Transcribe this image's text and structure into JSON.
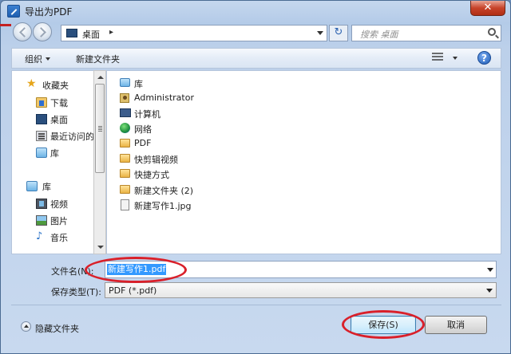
{
  "window": {
    "title": "导出为PDF",
    "close_label": "✕"
  },
  "address": {
    "location": "桌面",
    "search_placeholder": "搜索 桌面"
  },
  "toolbar": {
    "organize_label": "组织",
    "new_folder_label": "新建文件夹",
    "help_label": "?"
  },
  "nav": {
    "favorites_label": "收藏夹",
    "favorites": [
      "下载",
      "桌面",
      "最近访问的",
      "库"
    ],
    "libraries_label": "库",
    "libraries": [
      "视频",
      "图片",
      "音乐"
    ]
  },
  "files": [
    {
      "name": "库",
      "icon": "library-icon"
    },
    {
      "name": "Administrator",
      "icon": "user-icon"
    },
    {
      "name": "计算机",
      "icon": "computer-icon"
    },
    {
      "name": "网络",
      "icon": "network-icon"
    },
    {
      "name": "PDF",
      "icon": "folder-icon"
    },
    {
      "name": "快剪辑视频",
      "icon": "folder-icon"
    },
    {
      "name": "快捷方式",
      "icon": "folder-icon"
    },
    {
      "name": "新建文件夹 (2)",
      "icon": "folder-icon"
    },
    {
      "name": "新建写作1.jpg",
      "icon": "image-file-icon"
    }
  ],
  "form": {
    "filename_label": "文件名(N):",
    "filename_value": "新建写作1.pdf",
    "filetype_label": "保存类型(T):",
    "filetype_value": "PDF (*.pdf)"
  },
  "footer": {
    "hide_folders_label": "隐藏文件夹",
    "save_label": "保存(S)",
    "cancel_label": "取消"
  },
  "colors": {
    "annotation": "#d9202a",
    "selection": "#3399ff"
  }
}
